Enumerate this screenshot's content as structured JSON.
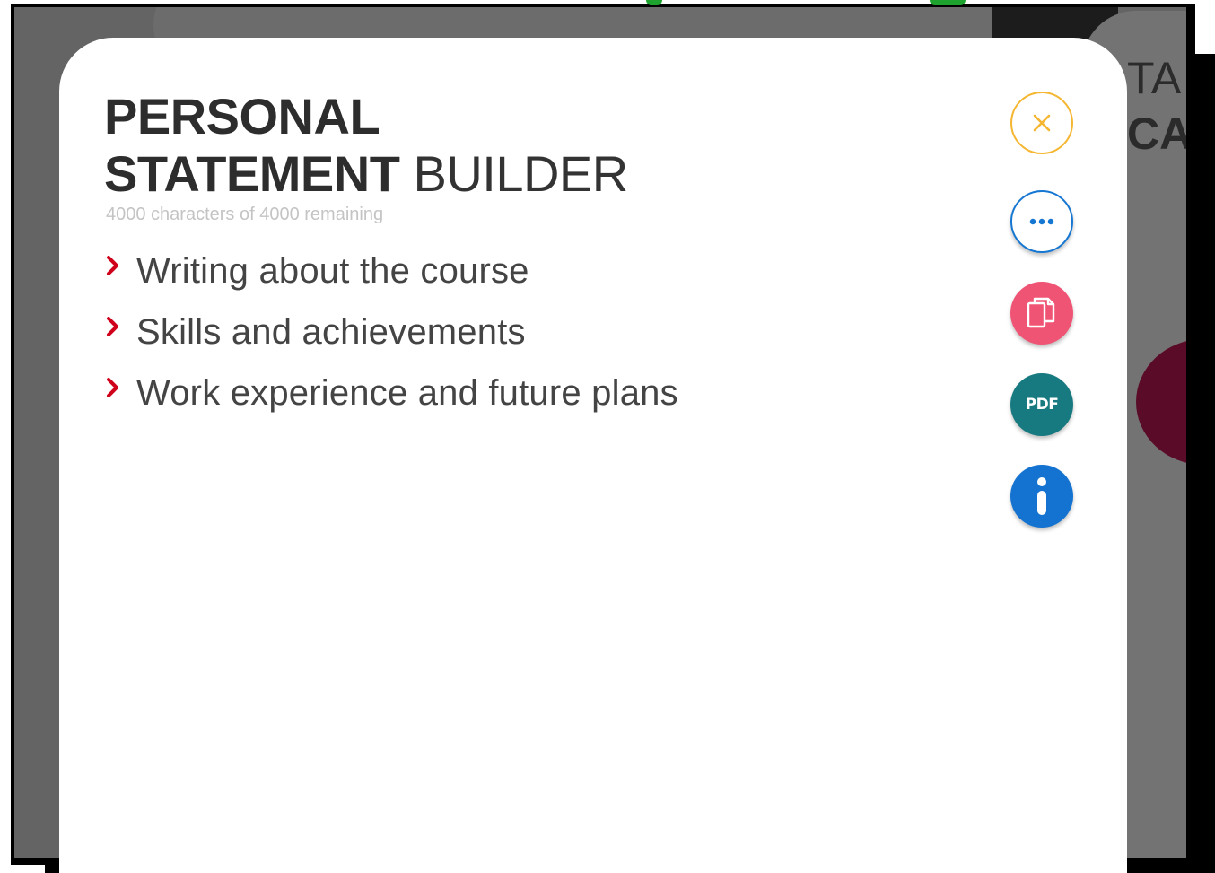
{
  "modal": {
    "title_line1": "PERSONAL",
    "title_line2_bold": "STATEMENT",
    "title_line2_light": "BUILDER",
    "char_count": "4000 characters of 4000 remaining",
    "sections": [
      {
        "label": "Writing about the course"
      },
      {
        "label": "Skills and achievements"
      },
      {
        "label": "Work experience and future plans"
      }
    ]
  },
  "actions": {
    "close": {
      "icon": "close-icon",
      "color": "#f5b631"
    },
    "more": {
      "icon": "more-icon",
      "color": "#1677d2"
    },
    "copy": {
      "icon": "copy-icon",
      "color": "#f05474"
    },
    "pdf": {
      "icon": "pdf-icon",
      "label": "PDF",
      "color": "#177a80"
    },
    "info": {
      "icon": "info-icon",
      "color": "#1473d1"
    }
  },
  "background": {
    "heading_line1": "TA",
    "heading_line2": "CA"
  },
  "colors": {
    "accent_red": "#d0021b",
    "overlay": "#646464"
  }
}
